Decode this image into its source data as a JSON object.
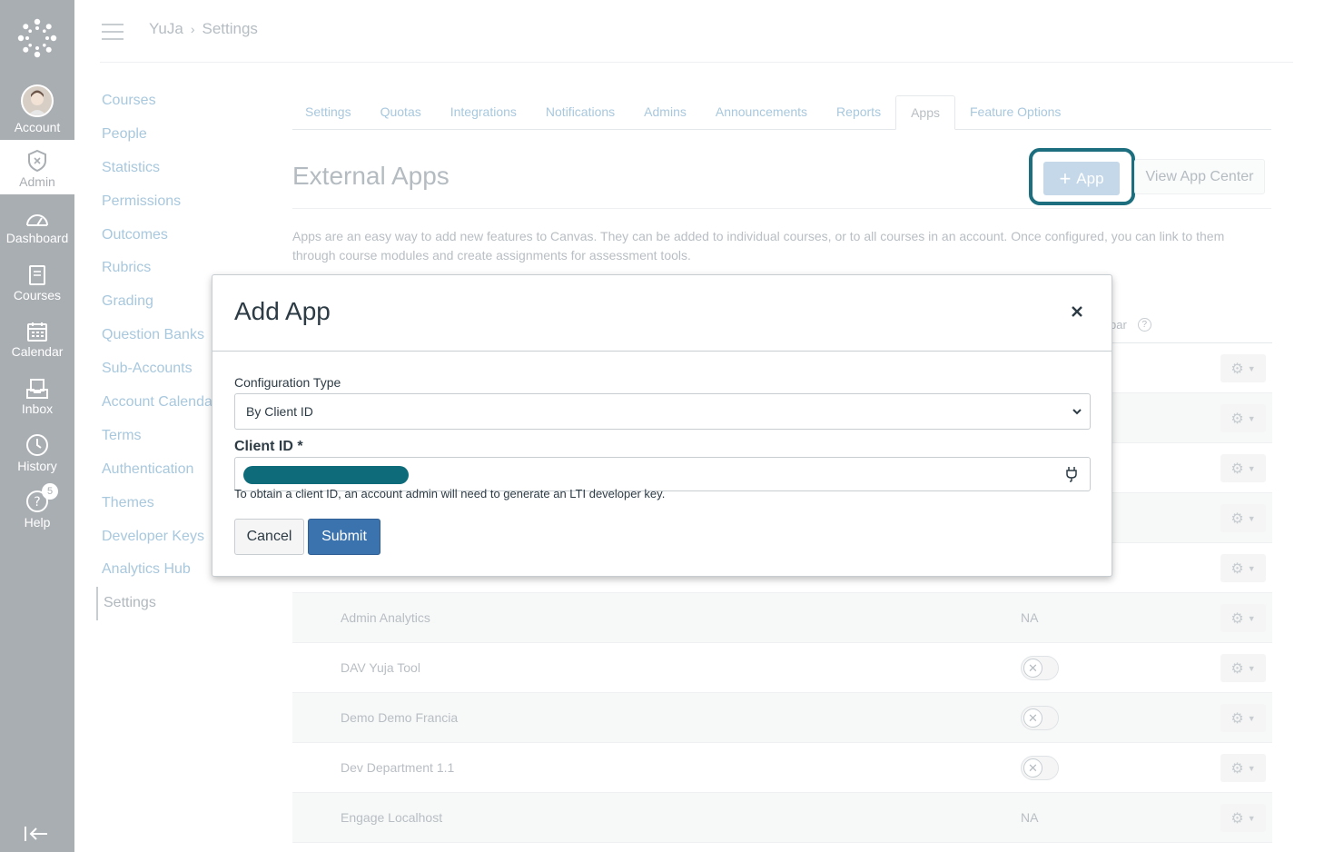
{
  "global_nav": {
    "items": [
      {
        "label": "Account"
      },
      {
        "label": "Admin"
      },
      {
        "label": "Dashboard"
      },
      {
        "label": "Courses"
      },
      {
        "label": "Calendar"
      },
      {
        "label": "Inbox"
      },
      {
        "label": "History"
      },
      {
        "label": "Help"
      }
    ],
    "help_badge": "5"
  },
  "breadcrumb": {
    "root": "YuJa",
    "current": "Settings"
  },
  "course_nav": [
    "Courses",
    "People",
    "Statistics",
    "Permissions",
    "Outcomes",
    "Rubrics",
    "Grading",
    "Question Banks",
    "Sub-Accounts",
    "Account Calendars",
    "Terms",
    "Authentication",
    "Themes",
    "Developer Keys",
    "Analytics Hub",
    "Settings"
  ],
  "tabs": [
    "Settings",
    "Quotas",
    "Integrations",
    "Notifications",
    "Admins",
    "Announcements",
    "Reports",
    "Apps",
    "Feature Options"
  ],
  "active_tab": "Apps",
  "page": {
    "title": "External Apps",
    "add_app_label": "App",
    "view_app_center_label": "View App Center",
    "description": "Apps are an easy way to add new features to Canvas. They can be added to individual courses, or to all courses in an account. Once configured, you can link to them through course modules and create assignments for assessment tools.",
    "column_header_partial": "bar",
    "help_q": "?"
  },
  "apps_table": [
    {
      "name": "",
      "status": ""
    },
    {
      "name": "",
      "status": ""
    },
    {
      "name": "",
      "status": ""
    },
    {
      "name": "",
      "status": ""
    },
    {
      "name": "",
      "status": ""
    },
    {
      "name": "Admin Analytics",
      "status": "NA"
    },
    {
      "name": "DAV Yuja Tool",
      "status": "toggle"
    },
    {
      "name": "Demo Demo Francia",
      "status": "toggle"
    },
    {
      "name": "Dev Department 1.1",
      "status": "toggle"
    },
    {
      "name": "Engage Localhost",
      "status": "NA"
    }
  ],
  "modal": {
    "title": "Add App",
    "close_glyph": "×",
    "config_type_label": "Configuration Type",
    "config_type_value": "By Client ID",
    "client_id_label": "Client ID *",
    "client_id_help": "To obtain a client ID, an account admin will need to generate an LTI developer key.",
    "cancel_label": "Cancel",
    "submit_label": "Submit"
  },
  "colors": {
    "nav_bg": "#a9aeb2",
    "submit": "#3b73af",
    "highlight": "#1d6e7e",
    "redaction": "#0e6b7a"
  }
}
